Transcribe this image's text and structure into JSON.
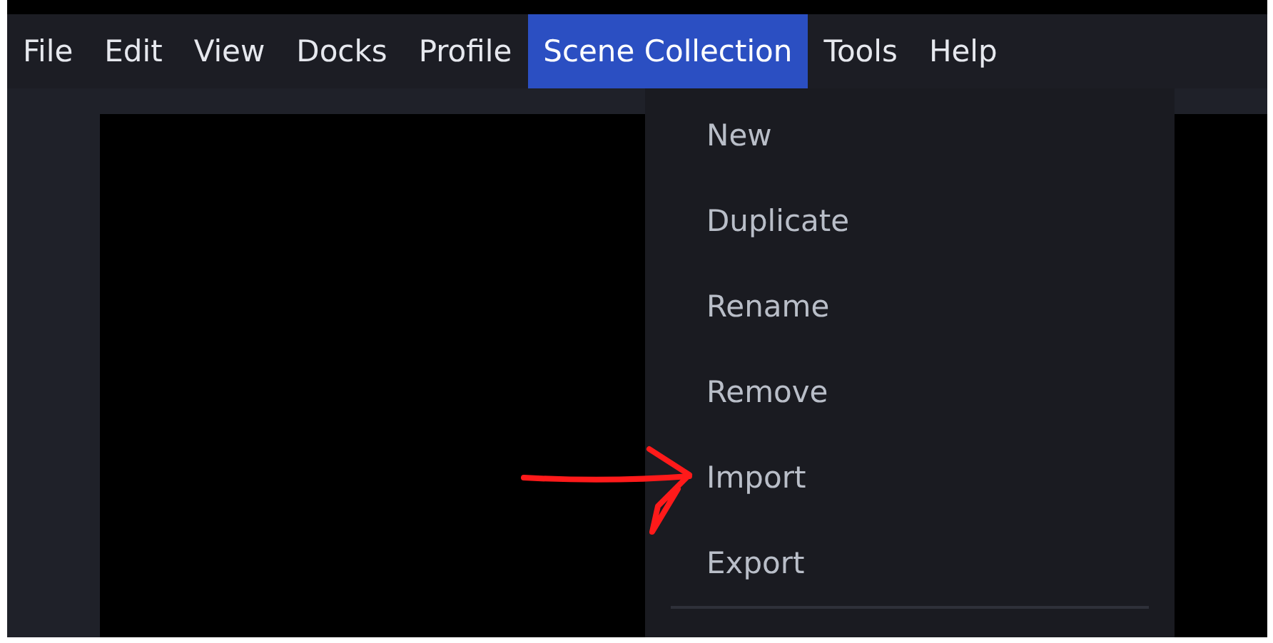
{
  "menu_bar": [
    {
      "label": "File",
      "selected": false
    },
    {
      "label": "Edit",
      "selected": false
    },
    {
      "label": "View",
      "selected": false
    },
    {
      "label": "Docks",
      "selected": false
    },
    {
      "label": "Profile",
      "selected": false
    },
    {
      "label": "Scene Collection",
      "selected": true
    },
    {
      "label": "Tools",
      "selected": false
    },
    {
      "label": "Help",
      "selected": false
    }
  ],
  "dropdown": {
    "items": [
      {
        "kind": "item",
        "label": "New"
      },
      {
        "kind": "item",
        "label": "Duplicate"
      },
      {
        "kind": "item",
        "label": "Rename"
      },
      {
        "kind": "item",
        "label": "Remove"
      },
      {
        "kind": "item",
        "label": "Import"
      },
      {
        "kind": "item",
        "label": "Export"
      },
      {
        "kind": "separator"
      }
    ]
  }
}
